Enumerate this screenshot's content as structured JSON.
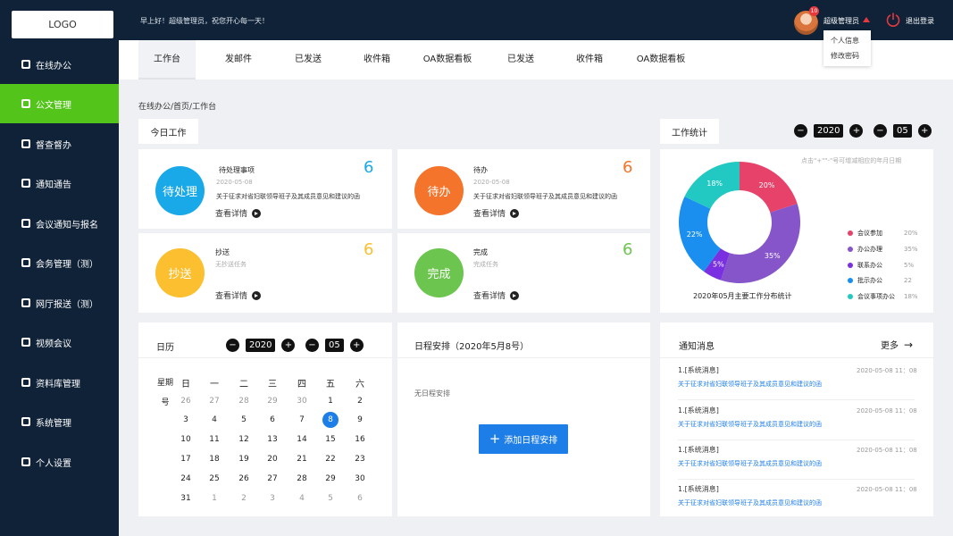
{
  "header": {
    "logo": "LOGO",
    "greeting": "早上好！超级管理员，祝您开心每一天！",
    "username": "超级管理员",
    "badge": "10",
    "logout": "退出登录",
    "menu": [
      "个人信息",
      "修改密码"
    ]
  },
  "sidebar": {
    "items": [
      {
        "label": "在线办公",
        "icon": "chart-icon"
      },
      {
        "label": "公文管理",
        "icon": "document-check-icon",
        "active": true
      },
      {
        "label": "督查督办",
        "icon": "supervise-icon"
      },
      {
        "label": "通知通告",
        "icon": "notice-icon"
      },
      {
        "label": "会议通知与报名",
        "icon": "meeting-icon"
      },
      {
        "label": "会务管理（测）",
        "icon": "file-icon"
      },
      {
        "label": "网厅报送（测）",
        "icon": "hall-icon"
      },
      {
        "label": "视频会议",
        "icon": "video-icon"
      },
      {
        "label": "资料库管理",
        "icon": "library-icon"
      },
      {
        "label": "系统管理",
        "icon": "system-icon"
      },
      {
        "label": "个人设置",
        "icon": "user-icon"
      }
    ]
  },
  "tabs": [
    "工作台",
    "发邮件",
    "已发送",
    "收件箱",
    "OA数据看板",
    "已发送",
    "收件箱",
    "OA数据看板"
  ],
  "breadcrumb": "在线办公/首页/工作台",
  "today": {
    "title": "今日工作",
    "cards": [
      {
        "circle": "待处理",
        "name": "待处理事项",
        "date": "2020-05-08",
        "desc": "关于征求对省妇联领导班子及其成员意见和建议的函",
        "count": "6",
        "link": "查看详情",
        "color": "#1aa9e8",
        "count_color": "#1aa9e8"
      },
      {
        "circle": "待办",
        "name": "待办",
        "date": "2020-05-08",
        "desc": "关于征求对省妇联领导班子及其成员意见和建议的函",
        "count": "6",
        "link": "查看详情",
        "color": "#f5742b",
        "count_color": "#f5742b"
      },
      {
        "circle": "抄送",
        "name": "抄送",
        "date": "无抄送任务",
        "desc": "",
        "count": "6",
        "link": "查看详情",
        "color": "#fcbf2f",
        "count_color": "#fcbf2f"
      },
      {
        "circle": "完成",
        "name": "完成",
        "date": "完成任务",
        "desc": "",
        "count": "6",
        "link": "查看详情",
        "color": "#6cc54e",
        "count_color": "#6cc54e"
      }
    ]
  },
  "stats": {
    "title": "工作统计",
    "year": "2020",
    "month": "05",
    "hint": "点击\"+\"\"-\"号可增减相应的年月日期",
    "caption": "2020年05月主要工作分布统计"
  },
  "chart_data": {
    "type": "pie",
    "title": "2020年05月主要工作分布统计",
    "series": [
      {
        "name": "会议参加",
        "value": 20,
        "label": "20%",
        "color": "#e6426a"
      },
      {
        "name": "办公办理",
        "value": 35,
        "label": "35%",
        "color": "#8655c9"
      },
      {
        "name": "联系办公",
        "value": 5,
        "label": "5%",
        "color": "#7a2fe0"
      },
      {
        "name": "批示办公",
        "value": 22,
        "label": "22%",
        "color": "#1a8ff0"
      },
      {
        "name": "会议事项办公",
        "value": 18,
        "label": "18%",
        "color": "#22c9c2"
      }
    ],
    "legend_values": [
      "20%",
      "35%",
      "5%",
      "22",
      "18%"
    ],
    "legend_position": "right"
  },
  "calendar": {
    "title": "日历",
    "year": "2020",
    "month": "05",
    "week_label_top": "星期",
    "week_label_bottom": "号",
    "weekdays": [
      "日",
      "一",
      "二",
      "三",
      "四",
      "五",
      "六"
    ],
    "rows": [
      [
        "26",
        "27",
        "28",
        "29",
        "30",
        "1",
        "2"
      ],
      [
        "3",
        "4",
        "5",
        "6",
        "7",
        "8",
        "9"
      ],
      [
        "10",
        "11",
        "12",
        "13",
        "14",
        "15",
        "16"
      ],
      [
        "17",
        "18",
        "19",
        "20",
        "21",
        "22",
        "23"
      ],
      [
        "24",
        "25",
        "26",
        "27",
        "28",
        "29",
        "30"
      ],
      [
        "31",
        "1",
        "2",
        "3",
        "4",
        "5",
        "6"
      ]
    ],
    "today": "8"
  },
  "schedule": {
    "title": "日程安排（2020年5月8号）",
    "empty": "无日程安排",
    "add": "添加日程安排"
  },
  "notices": {
    "title": "通知消息",
    "more": "更多",
    "items": [
      {
        "head": "1.[系统消息]",
        "time": "2020-05-08 11：08",
        "body": "关于征求对省妇联领导班子及其成员意见和建议的函"
      },
      {
        "head": "1.[系统消息]",
        "time": "2020-05-08 11：08",
        "body": "关于征求对省妇联领导班子及其成员意见和建议的函"
      },
      {
        "head": "1.[系统消息]",
        "time": "2020-05-08 11：08",
        "body": "关于征求对省妇联领导班子及其成员意见和建议的函"
      },
      {
        "head": "1.[系统消息]",
        "time": "2020-05-08 11：08",
        "body": "关于征求对省妇联领导班子及其成员意见和建议的函"
      }
    ]
  },
  "controls": {
    "minus": "−",
    "plus": "+"
  }
}
